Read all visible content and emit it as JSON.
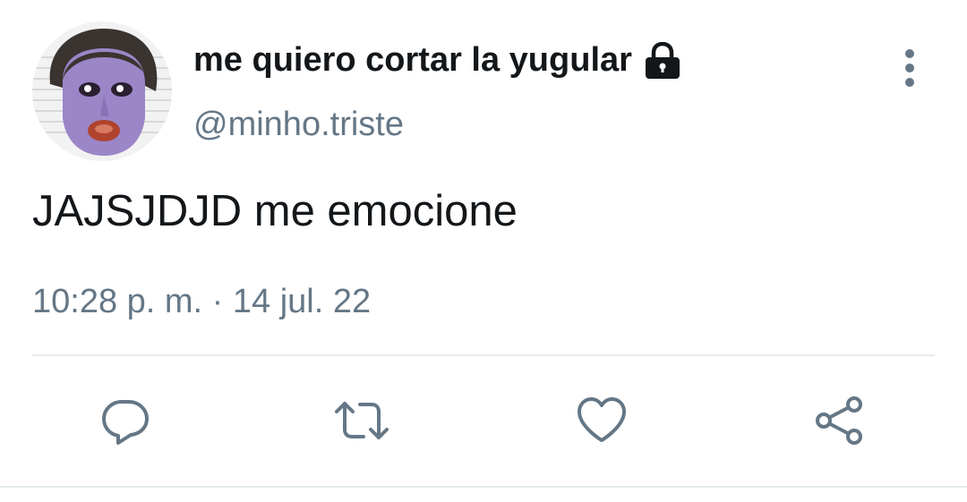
{
  "tweet": {
    "author": {
      "display_name": "me quiero cortar la yugular",
      "handle": "@minho.triste",
      "protected_icon": "lock-icon",
      "avatar_icon": "avatar-photo"
    },
    "text": "JAJSJDJD me emocione",
    "timestamp": "10:28 p. m. · 14 jul. 22",
    "menu_icon": "more-vertical-icon"
  },
  "actions": [
    {
      "name": "reply",
      "icon": "reply-icon"
    },
    {
      "name": "retweet",
      "icon": "retweet-icon"
    },
    {
      "name": "like",
      "icon": "heart-icon"
    },
    {
      "name": "share",
      "icon": "share-icon"
    }
  ],
  "colors": {
    "text_primary": "#14171a",
    "text_secondary": "#657786",
    "icon": "#657786",
    "divider": "#e6ecf0"
  }
}
